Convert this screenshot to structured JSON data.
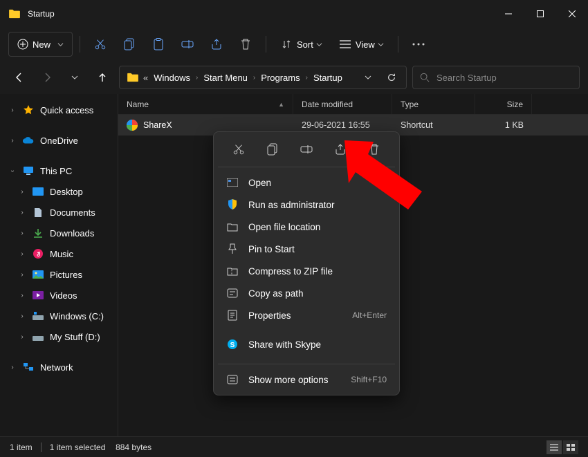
{
  "window": {
    "title": "Startup"
  },
  "toolbar": {
    "new_label": "New",
    "sort_label": "Sort",
    "view_label": "View"
  },
  "breadcrumbs": {
    "hidden_prefix": "«",
    "items": [
      "Windows",
      "Start Menu",
      "Programs",
      "Startup"
    ]
  },
  "search": {
    "placeholder": "Search Startup"
  },
  "sidebar": {
    "quick_access": "Quick access",
    "onedrive": "OneDrive",
    "this_pc": "This PC",
    "desktop": "Desktop",
    "documents": "Documents",
    "downloads": "Downloads",
    "music": "Music",
    "pictures": "Pictures",
    "videos": "Videos",
    "windows_c": "Windows (C:)",
    "mystuff_d": "My Stuff (D:)",
    "network": "Network"
  },
  "columns": {
    "name": "Name",
    "date": "Date modified",
    "type": "Type",
    "size": "Size"
  },
  "files": [
    {
      "name": "ShareX",
      "date": "29-06-2021 16:55",
      "type": "Shortcut",
      "size": "1 KB"
    }
  ],
  "context_menu": {
    "open": "Open",
    "run_admin": "Run as administrator",
    "open_location": "Open file location",
    "pin_start": "Pin to Start",
    "compress": "Compress to ZIP file",
    "copy_path": "Copy as path",
    "properties": "Properties",
    "properties_shortcut": "Alt+Enter",
    "share_skype": "Share with Skype",
    "more_options": "Show more options",
    "more_options_shortcut": "Shift+F10"
  },
  "status": {
    "count": "1 item",
    "selected": "1 item selected",
    "bytes": "884 bytes"
  }
}
